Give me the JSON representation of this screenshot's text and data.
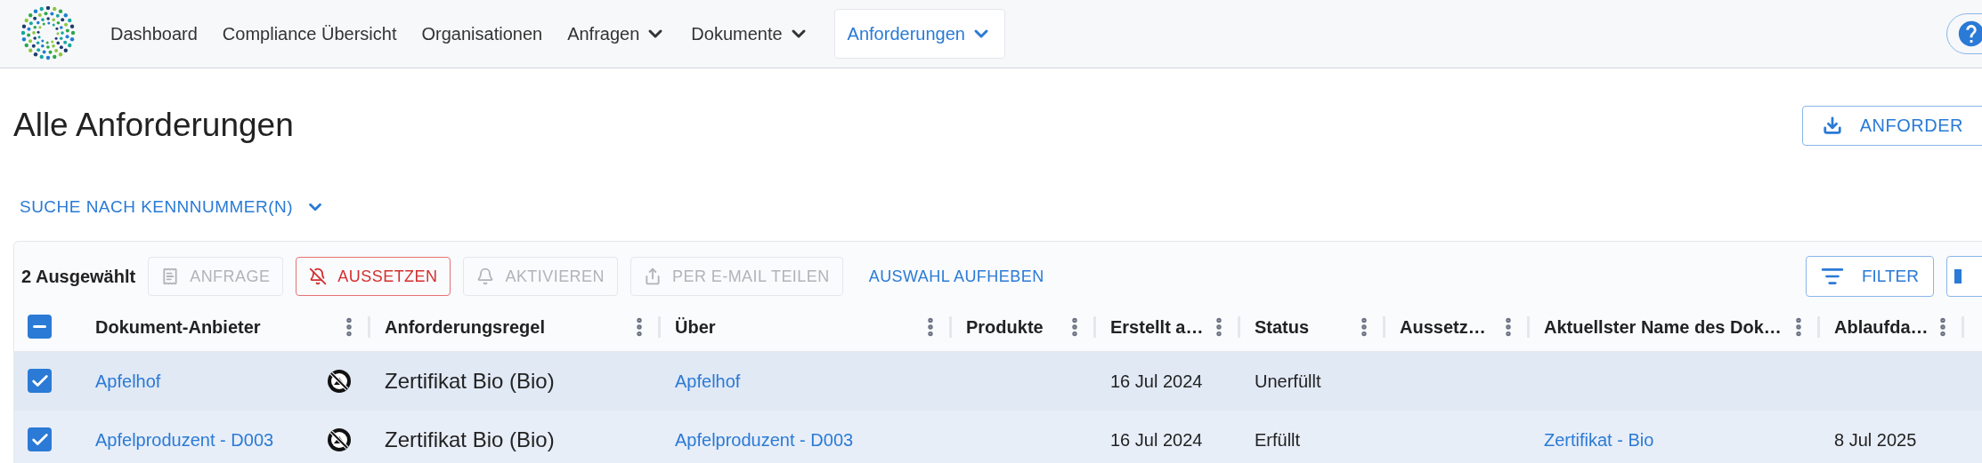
{
  "nav": {
    "items": [
      {
        "label": "Dashboard",
        "dropdown": false,
        "selected": false
      },
      {
        "label": "Compliance Übersicht",
        "dropdown": false,
        "selected": false
      },
      {
        "label": "Organisationen",
        "dropdown": false,
        "selected": false
      },
      {
        "label": "Anfragen",
        "dropdown": true,
        "selected": false
      },
      {
        "label": "Dokumente",
        "dropdown": true,
        "selected": false
      },
      {
        "label": "Anforderungen",
        "dropdown": true,
        "selected": true
      }
    ]
  },
  "page": {
    "title": "Alle Anforderungen",
    "export_button": "ANFORDER",
    "search_toggle": "SUCHE NACH KENNNUMMER(N)"
  },
  "toolbar": {
    "selection_count": "2 Ausgewählt",
    "actions": [
      {
        "label": "ANFRAGE",
        "kind": "outlined",
        "disabled": true
      },
      {
        "label": "AUSSETZEN",
        "kind": "danger",
        "disabled": false
      },
      {
        "label": "AKTIVIEREN",
        "kind": "outlined",
        "disabled": true
      },
      {
        "label": "PER E-MAIL TEILEN",
        "kind": "outlined",
        "disabled": true
      },
      {
        "label": "AUSWAHL AUFHEBEN",
        "kind": "text",
        "disabled": false
      }
    ],
    "filter_button": "FILTER"
  },
  "table": {
    "select_all_partial": true,
    "columns": [
      "Dokument-Anbieter",
      "Anforderungsregel",
      "Über",
      "Produkte",
      "Erstellt a…",
      "Status",
      "Aussetz…",
      "Aktuellster Name des Dok…",
      "Ablaufda…"
    ],
    "rows": [
      {
        "selected": true,
        "suspended": true,
        "provider": "Apfelhof",
        "rule": "Zertifikat Bio (Bio)",
        "about": "Apfelhof",
        "created": "16 Jul 2024",
        "status": "Unerfüllt"
      },
      {
        "selected": true,
        "suspended": true,
        "provider": "Apfelproduzent - D003",
        "rule": "Zertifikat Bio (Bio)",
        "about": "Apfelproduzent - D003",
        "created": "16 Jul 2024",
        "status": "Erfüllt",
        "document": "Zertifikat - Bio",
        "expiry": "8 Jul 2025"
      }
    ]
  }
}
